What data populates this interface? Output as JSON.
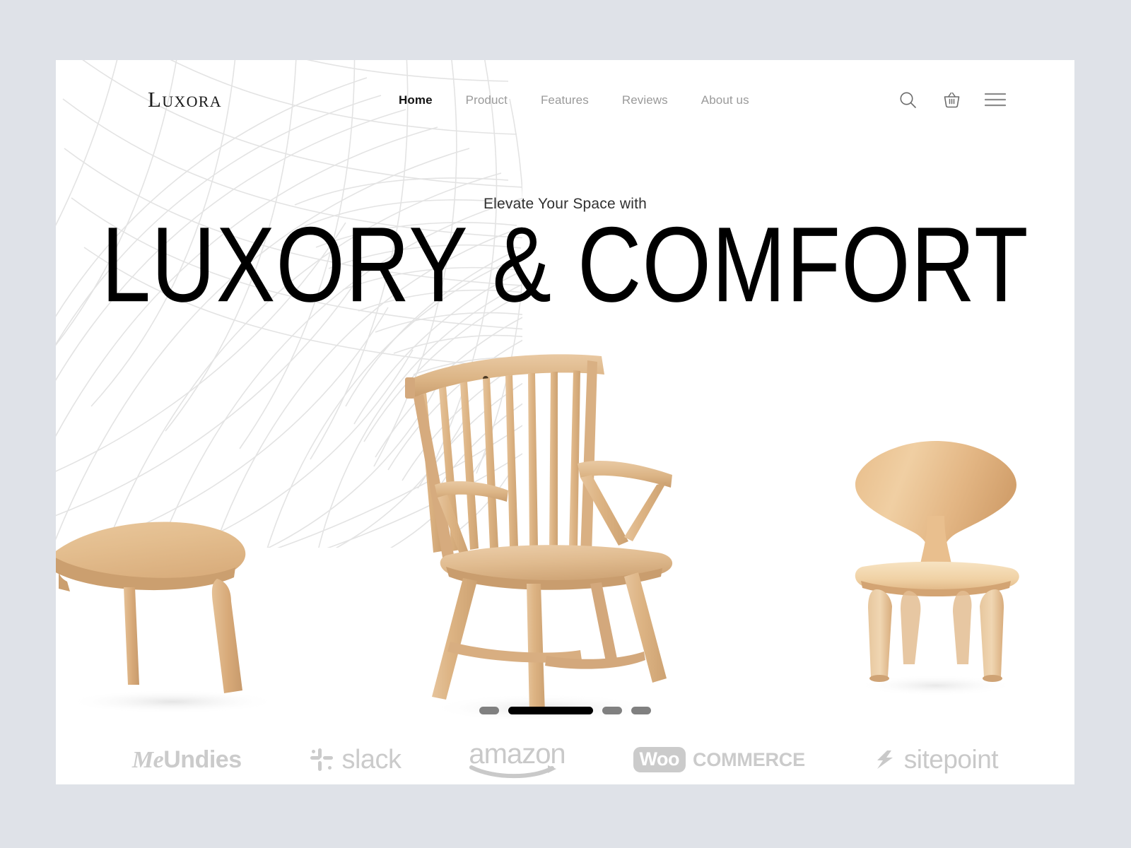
{
  "page": {
    "background_color": "#dfe2e8",
    "card_background": "#ffffff"
  },
  "header": {
    "logo": "Luxora",
    "nav": [
      {
        "label": "Home",
        "active": true
      },
      {
        "label": "Product",
        "active": false
      },
      {
        "label": "Features",
        "active": false
      },
      {
        "label": "Reviews",
        "active": false
      },
      {
        "label": "About us",
        "active": false
      }
    ],
    "actions": [
      {
        "name": "search-icon",
        "label": "Search"
      },
      {
        "name": "cart-icon",
        "label": "Cart"
      },
      {
        "name": "hamburger-menu-icon",
        "label": "Menu"
      }
    ]
  },
  "hero": {
    "eyebrow": "Elevate Your Space with",
    "headline": "LUXORY & COMFORT",
    "accent_color": "#000000",
    "muted_color": "#9a9a9a"
  },
  "carousel": {
    "total_slides": 4,
    "active_slide": 2,
    "dots": [
      {
        "active": false
      },
      {
        "active": true
      },
      {
        "active": false
      },
      {
        "active": false
      }
    ]
  },
  "products": [
    {
      "name": "wooden-coffee-table",
      "label": "Wooden coffee table"
    },
    {
      "name": "windsor-spindle-armchair",
      "label": "Windsor spindle armchair"
    },
    {
      "name": "molded-plywood-side-chair",
      "label": "Molded plywood side chair"
    }
  ],
  "brands": [
    {
      "name": "meundies-logo",
      "part1": "Me",
      "part2": "Undies"
    },
    {
      "name": "slack-logo",
      "label": "slack"
    },
    {
      "name": "amazon-logo",
      "label": "amazon"
    },
    {
      "name": "woocommerce-logo",
      "badge": "Woo",
      "label": "COMMERCE"
    },
    {
      "name": "sitepoint-logo",
      "label": "sitepoint"
    }
  ]
}
